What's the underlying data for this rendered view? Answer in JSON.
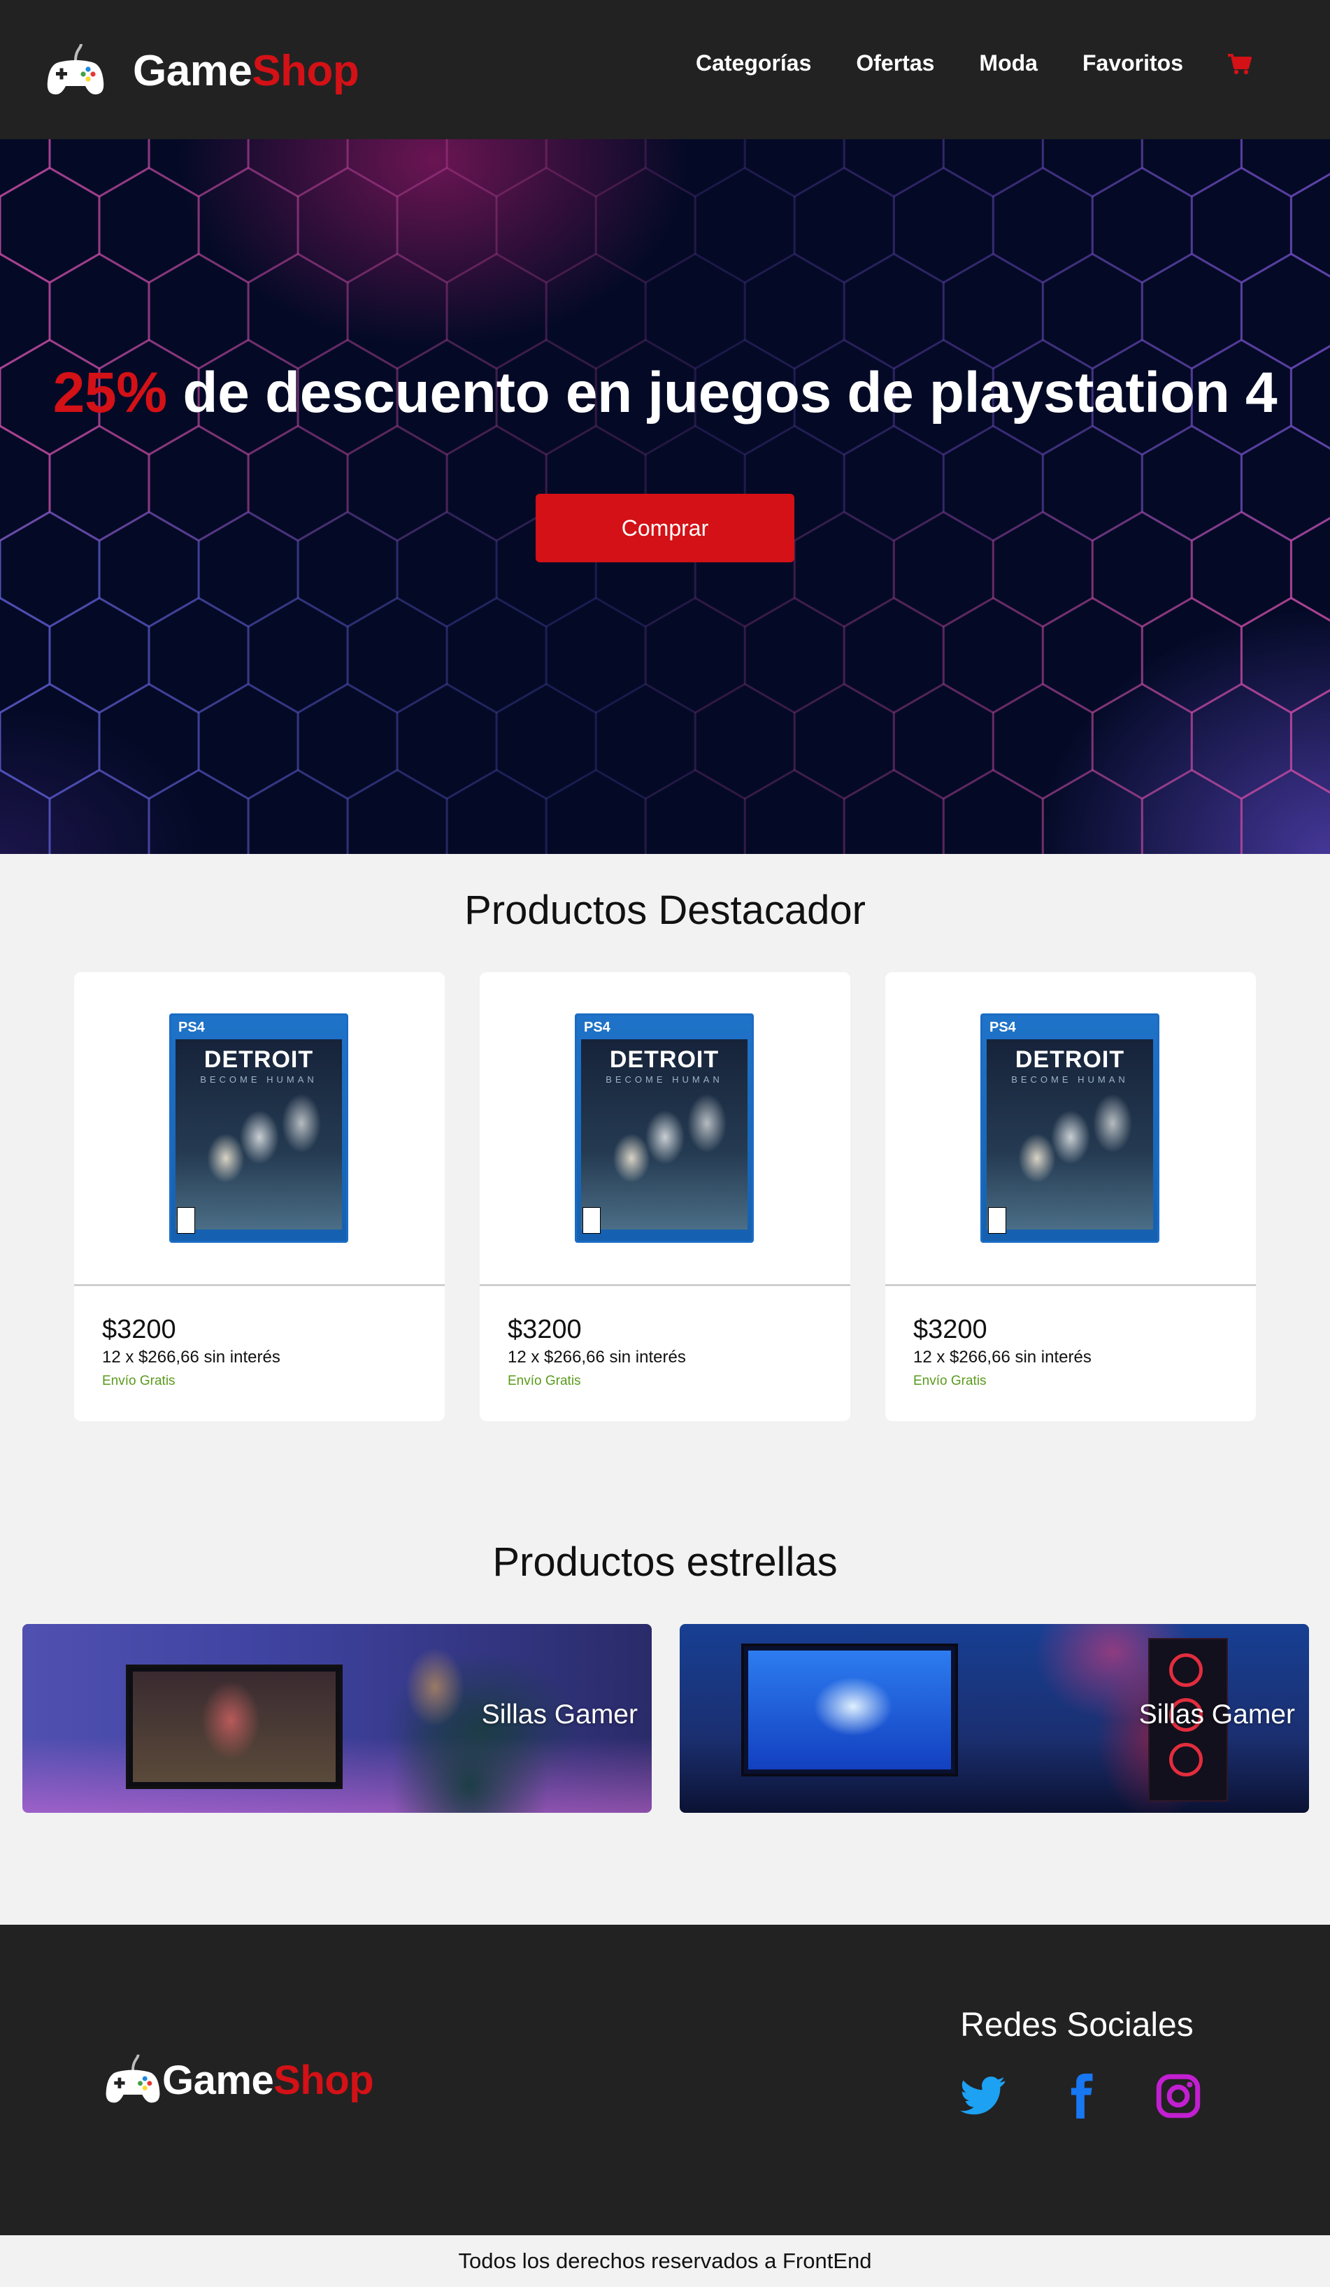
{
  "header": {
    "brand_part1": "Game",
    "brand_part2": "Shop",
    "nav": [
      "Categorías",
      "Ofertas",
      "Moda",
      "Favoritos"
    ],
    "cart_icon": "cart-icon"
  },
  "hero": {
    "highlight": "25%",
    "title_rest": " de descuento en juegos de playstation 4",
    "button": "Comprar"
  },
  "featured": {
    "title": "Productos Destacador",
    "products": [
      {
        "platform": "PS4",
        "game_title": "DETROIT",
        "game_subtitle": "BECOME HUMAN",
        "price": "$3200",
        "installments": "12 x $266,66 sin interés",
        "shipping": "Envío Gratis"
      },
      {
        "platform": "PS4",
        "game_title": "DETROIT",
        "game_subtitle": "BECOME HUMAN",
        "price": "$3200",
        "installments": "12 x $266,66 sin interés",
        "shipping": "Envío Gratis"
      },
      {
        "platform": "PS4",
        "game_title": "DETROIT",
        "game_subtitle": "BECOME HUMAN",
        "price": "$3200",
        "installments": "12 x $266,66 sin interés",
        "shipping": "Envío Gratis"
      }
    ]
  },
  "stars": {
    "title": "Productos estrellas",
    "banners": [
      {
        "label": "Sillas Gamer"
      },
      {
        "label": "Sillas Gamer"
      }
    ]
  },
  "footer": {
    "brand_part1": "Game",
    "brand_part2": "Shop",
    "social_title": "Redes Sociales",
    "social_icons": [
      "twitter-icon",
      "facebook-icon",
      "instagram-icon"
    ],
    "copyright": "Todos los derechos reservados a FrontEnd"
  },
  "colors": {
    "accent": "#d31116",
    "dark": "#222222",
    "background": "#f2f2f2",
    "shipping_green": "#5a9a1b",
    "twitter": "#1da1f2",
    "facebook": "#1877f2",
    "instagram": "#c13584"
  }
}
